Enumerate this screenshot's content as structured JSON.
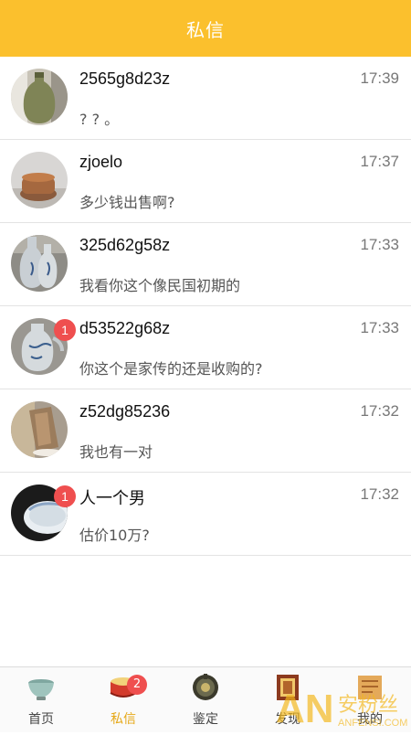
{
  "header": {
    "title": "私信"
  },
  "messages": [
    {
      "name": "2565g8d23z",
      "time": "17:39",
      "text": "? ? 。",
      "badge": ""
    },
    {
      "name": "zjoelo",
      "time": "17:37",
      "text": "多少钱出售啊?",
      "badge": ""
    },
    {
      "name": "325d62g58z",
      "time": "17:33",
      "text": "我看你这个像民国初期的",
      "badge": ""
    },
    {
      "name": "d53522g68z",
      "time": "17:33",
      "text": "你这个是家传的还是收购的?",
      "badge": "1"
    },
    {
      "name": "z52dg85236",
      "time": "17:32",
      "text": "我也有一对",
      "badge": ""
    },
    {
      "name": "人一个男",
      "time": "17:32",
      "text": "估价10万?",
      "badge": "1"
    }
  ],
  "tabbar": {
    "tabs": [
      {
        "label": "首页",
        "icon": "bowl-icon",
        "active": false
      },
      {
        "label": "私信",
        "icon": "drum-icon",
        "active": true,
        "badge": "2"
      },
      {
        "label": "鉴定",
        "icon": "compass-icon",
        "active": false
      },
      {
        "label": "发现",
        "icon": "shrine-icon",
        "active": false
      },
      {
        "label": "我的",
        "icon": "scroll-icon",
        "active": false
      }
    ]
  },
  "watermark": {
    "text": "AN 安粉丝",
    "subtext": "ANFENSI.COM"
  },
  "colors": {
    "header_bg": "#fbc02d",
    "badge": "#ef4f4f",
    "active_tab": "#e6a817"
  }
}
